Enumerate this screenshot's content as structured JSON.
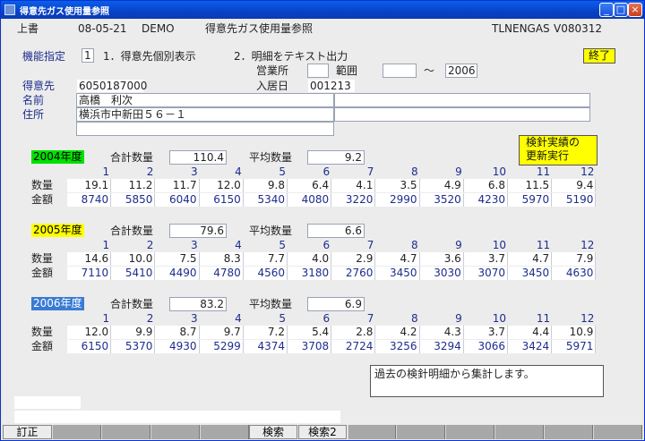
{
  "window": {
    "title": "得意先ガス使用量参照",
    "min": "_",
    "max": "□",
    "close": "×"
  },
  "header": {
    "mode": "上書",
    "date": "08-05-21",
    "user": "DEMO",
    "screen_title": "得意先ガス使用量参照",
    "program_id": "TLNENGAS",
    "version": "V080312"
  },
  "function": {
    "label": "機能指定",
    "value": "1",
    "option1": "1．得意先個別表示",
    "option2": "2．明細をテキスト出力",
    "exit_label": "終了"
  },
  "filter": {
    "office_label": "営業所",
    "office_value": "",
    "range_label": "範囲",
    "range_from": "",
    "tilde": "～",
    "range_to": "2006"
  },
  "customer": {
    "code_label": "得意先",
    "code": "6050187000",
    "movein_label": "入居日",
    "movein": "001213",
    "name_label": "名前",
    "name": "高橋　利次",
    "address_label": "住所",
    "address": "横浜市中新田５６－１"
  },
  "update_button": {
    "line1": "検針実績の",
    "line2": "更新実行"
  },
  "labels": {
    "total_qty": "合計数量",
    "avg_qty": "平均数量",
    "qty": "数量",
    "amount": "金額"
  },
  "months": [
    "1",
    "2",
    "3",
    "4",
    "5",
    "6",
    "7",
    "8",
    "9",
    "10",
    "11",
    "12"
  ],
  "years": [
    {
      "label": "2004年度",
      "bg": "#00e000",
      "fg": "#000000",
      "total": "110.4",
      "avg": "9.2",
      "qty": [
        "19.1",
        "11.2",
        "11.7",
        "12.0",
        "9.8",
        "6.4",
        "4.1",
        "3.5",
        "4.9",
        "6.8",
        "11.5",
        "9.4"
      ],
      "amount": [
        "8740",
        "5850",
        "6040",
        "6150",
        "5340",
        "4080",
        "3220",
        "2990",
        "3520",
        "4230",
        "5970",
        "5190"
      ]
    },
    {
      "label": "2005年度",
      "bg": "#ffff00",
      "fg": "#000000",
      "total": "79.6",
      "avg": "6.6",
      "qty": [
        "14.6",
        "10.0",
        "7.5",
        "8.3",
        "7.7",
        "4.0",
        "2.9",
        "4.7",
        "3.6",
        "3.7",
        "4.7",
        "7.9"
      ],
      "amount": [
        "7110",
        "5410",
        "4490",
        "4780",
        "4560",
        "3180",
        "2760",
        "3450",
        "3030",
        "3070",
        "3450",
        "4630"
      ]
    },
    {
      "label": "2006年度",
      "bg": "#3a7bd5",
      "fg": "#ffffff",
      "total": "83.2",
      "avg": "6.9",
      "qty": [
        "12.0",
        "9.9",
        "8.7",
        "9.7",
        "7.2",
        "5.4",
        "2.8",
        "4.2",
        "4.3",
        "3.7",
        "4.4",
        "10.9"
      ],
      "amount": [
        "6150",
        "5370",
        "4930",
        "5299",
        "4374",
        "3708",
        "2724",
        "3256",
        "3294",
        "3066",
        "3424",
        "5971"
      ]
    }
  ],
  "message": "過去の検針明細から集計します。",
  "fkeys": [
    "訂正",
    "",
    "",
    "",
    "",
    "検索",
    "検索2",
    "",
    "",
    "",
    "",
    "",
    ""
  ]
}
